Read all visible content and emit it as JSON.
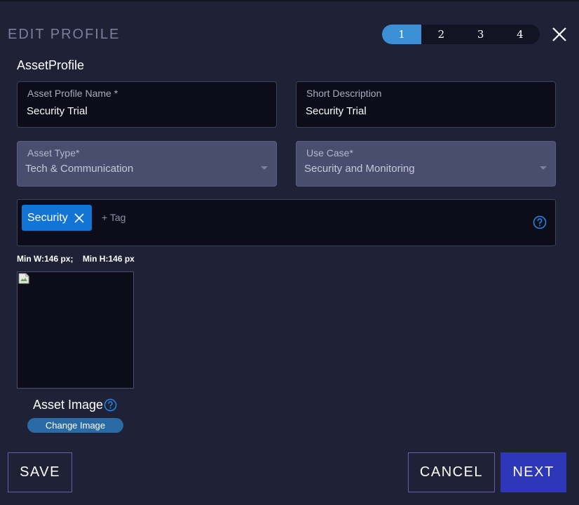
{
  "dialog": {
    "title": "EDIT PROFILE",
    "steps": [
      "1",
      "2",
      "3",
      "4"
    ],
    "active_step": 1
  },
  "section_title": "AssetProfile",
  "fields": {
    "asset_profile_name": {
      "label": "Asset Profile Name *",
      "value": "Security Trial"
    },
    "short_description": {
      "label": "Short Description",
      "value": "Security Trial"
    },
    "asset_type": {
      "label": "Asset Type*",
      "value": "Tech & Communication"
    },
    "use_case": {
      "label": "Use Case*",
      "value": "Security and Monitoring"
    }
  },
  "tags": {
    "items": [
      "Security"
    ],
    "placeholder": "+ Tag"
  },
  "image": {
    "min_width": "Min W:146 px;",
    "min_height": "Min H:146 px",
    "label": "Asset Image",
    "change_label": "Change Image"
  },
  "footer": {
    "save_label": "SAVE",
    "cancel_label": "CANCEL",
    "next_label": "NEXT"
  },
  "colors": {
    "background": "#1f2136",
    "accent": "#3a8fd6",
    "tag_chip": "#1275d6",
    "next_button": "#2e37b8"
  },
  "icons": [
    "close-icon",
    "tag-remove-icon",
    "help-icon",
    "broken-image-icon",
    "chevron-down-icon"
  ]
}
